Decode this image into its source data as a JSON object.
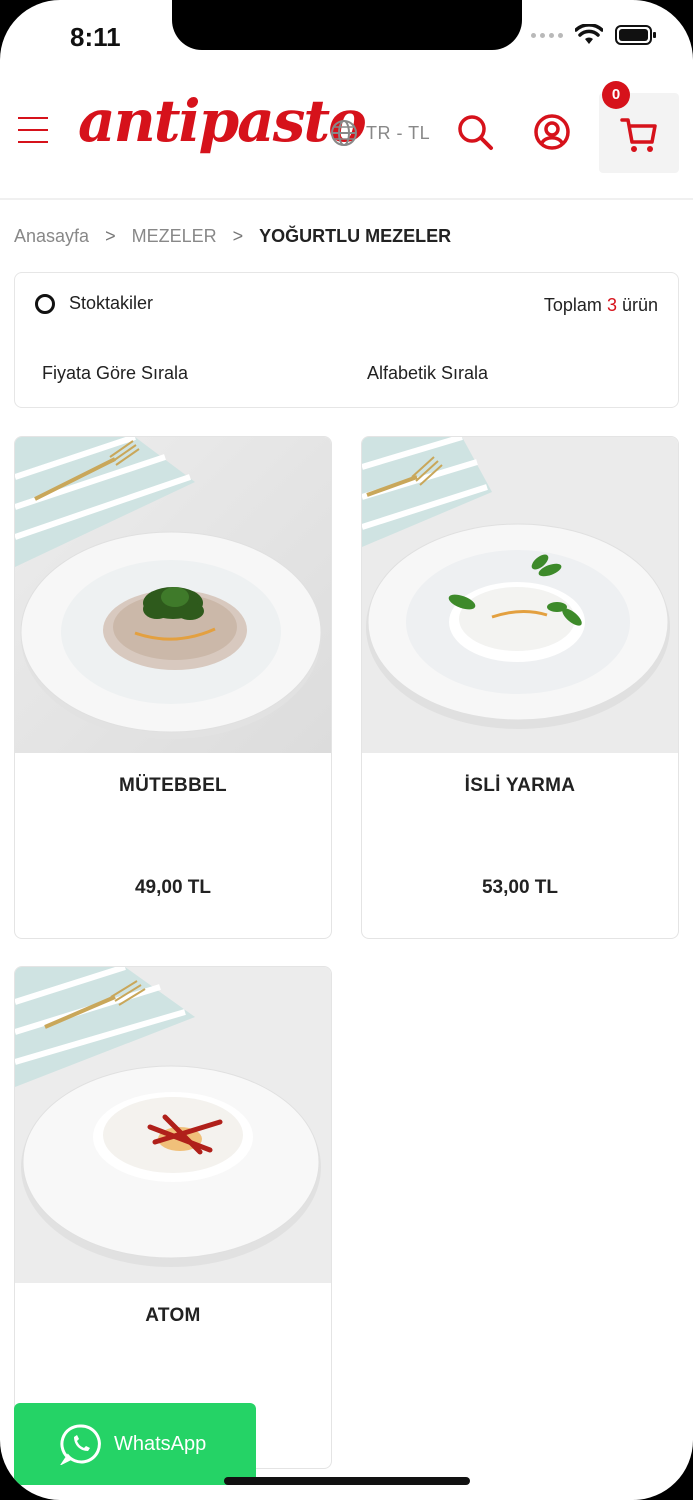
{
  "status_bar": {
    "time": "8:11"
  },
  "header": {
    "logo": "antipasto",
    "language": "TR - TL",
    "cart_count": "0"
  },
  "breadcrumb": {
    "home": "Anasayfa",
    "sep1": ">",
    "category": "MEZELER",
    "sep2": ">",
    "current": "YOĞURTLU MEZELER"
  },
  "filter": {
    "stock_label": "Stoktakiler",
    "total_prefix": "Toplam",
    "total_count": "3",
    "total_suffix": "ürün",
    "sort_price": "Fiyata Göre Sırala",
    "sort_alpha": "Alfabetik Sırala"
  },
  "products": [
    {
      "name": "MÜTEBBEL",
      "price": "49,00 TL"
    },
    {
      "name": "İSLİ YARMA",
      "price": "53,00 TL"
    },
    {
      "name": "ATOM",
      "price": ""
    }
  ],
  "whatsapp": {
    "label": "WhatsApp"
  },
  "colors": {
    "brand": "#d6121b",
    "whatsapp": "#25d366"
  }
}
